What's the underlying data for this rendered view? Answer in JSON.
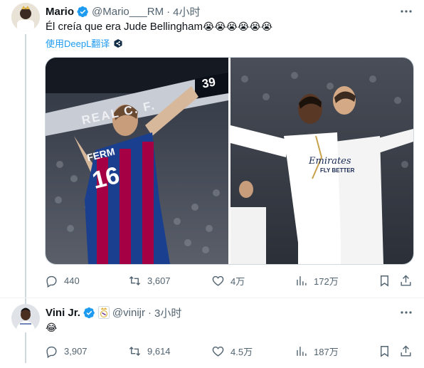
{
  "tweet1": {
    "display_name": "Mario",
    "handle": "@Mario___RM",
    "sep": "·",
    "time": "4小时",
    "text": "Él creía que era Jude Bellingham",
    "emoji": "😭😭😭😭😭😭",
    "translate_label": "使用DeepL翻译",
    "media": {
      "left_scoreboard": "REAL C. F.",
      "left_clock": "39",
      "left_player_number": "16",
      "left_player_name": "FERM",
      "right_sponsor": "Emirates",
      "right_sponsor_sub": "FLY BETTER"
    },
    "actions": {
      "replies": "440",
      "retweets": "3,607",
      "likes": "4万",
      "views": "172万"
    }
  },
  "tweet2": {
    "display_name": "Vini Jr.",
    "handle": "@vinijr",
    "sep": "·",
    "time": "3小时",
    "emoji": "😂",
    "actions": {
      "replies": "3,907",
      "retweets": "9,614",
      "likes": "4.5万",
      "views": "187万"
    }
  },
  "colors": {
    "accent": "#1d9bf0",
    "muted": "#536471",
    "barca_blue": "#1b3f8f",
    "barca_red": "#a50044"
  }
}
